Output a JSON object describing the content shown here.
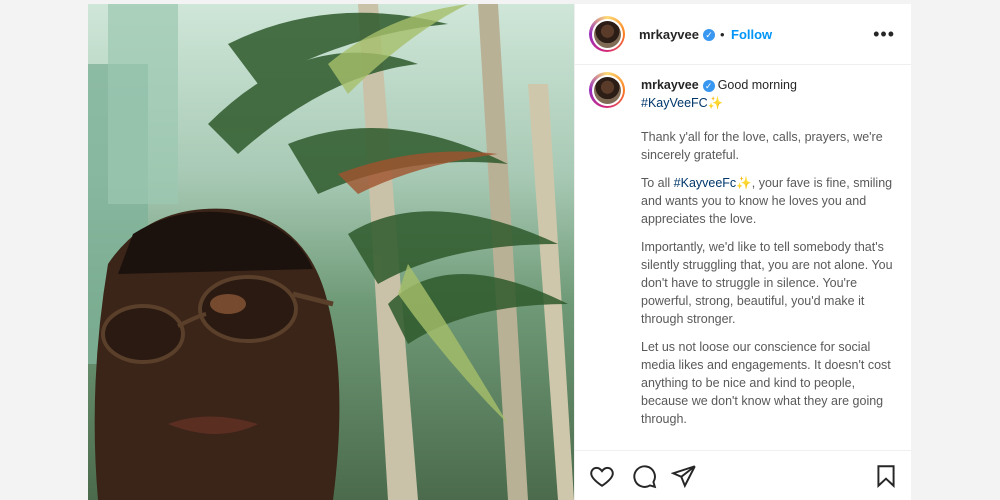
{
  "post": {
    "username": "mrkayvee",
    "verified_mark": "✓",
    "separator": "•",
    "follow_label": "Follow",
    "more_label": "•••",
    "caption": {
      "greeting": "Good morning",
      "hashtag_line": "#KayVeeFC",
      "sparkle": "✨",
      "paragraph1": "Thank y'all for the love, calls, prayers, we're sincerely grateful.",
      "paragraph2_tag": "#KayveeFc",
      "paragraph2_rest": ", your fave is fine, smiling and wants you to know he loves you and appreciates the love.",
      "paragraph3": "Importantly, we'd like to tell somebody that's silently struggling that, you are not alone. You don't have to struggle in silence. You're powerful, strong, beautiful, you'd make it through stronger.",
      "paragraph4": "Let us not loose our conscience for social media likes and engagements. It doesn't cost anything to be nice and kind to people, because we don't know what they are going through."
    },
    "icons": {
      "like": "heart-icon",
      "comment": "comment-icon",
      "share": "share-icon",
      "save": "bookmark-icon",
      "avatar": "avatar",
      "more": "more-icon"
    },
    "colors": {
      "follow": "#0095f6",
      "hashtag": "#00376b",
      "verified": "#3897f0"
    }
  }
}
